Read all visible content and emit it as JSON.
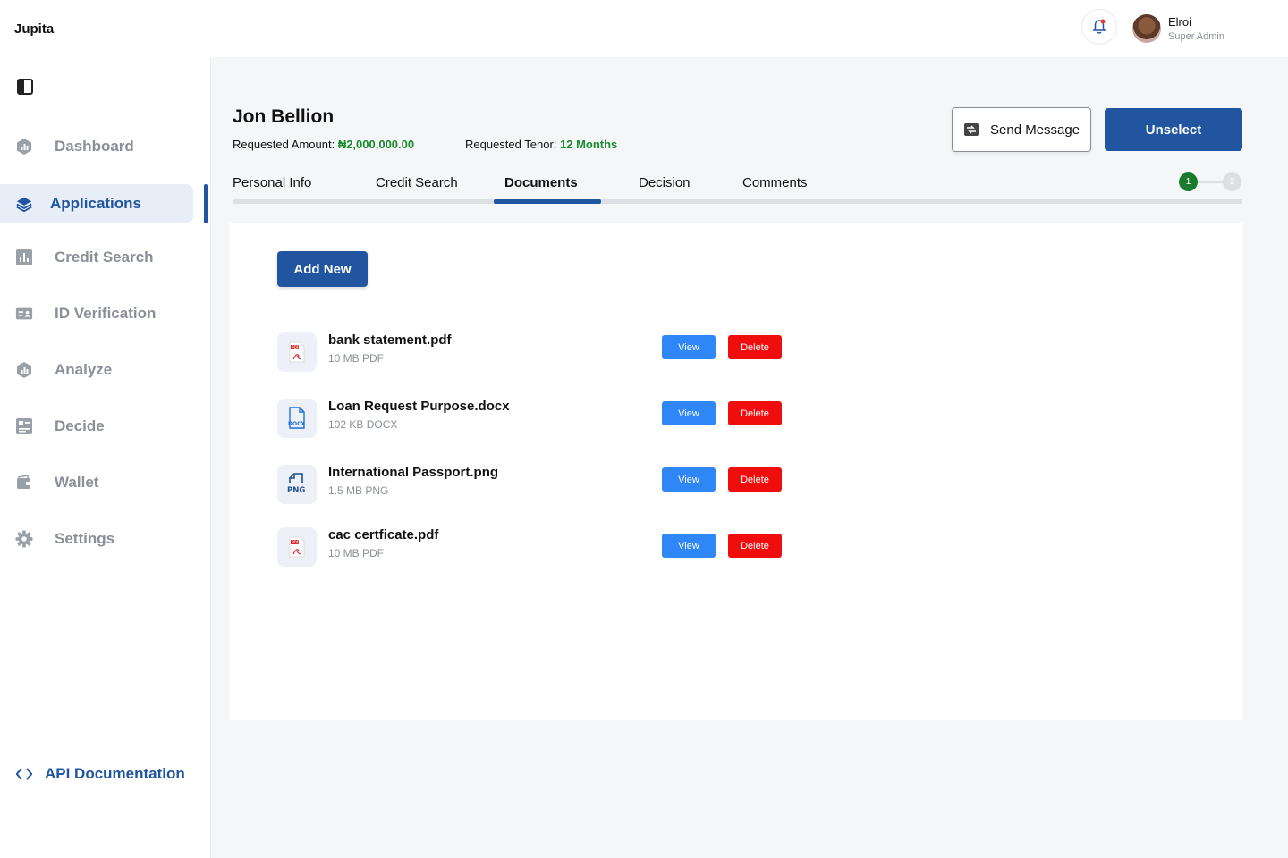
{
  "brand": "Jupita",
  "user": {
    "name": "Elroi",
    "role": "Super Admin"
  },
  "sidebar": {
    "items": [
      {
        "label": "Dashboard",
        "icon": "dashboard-icon"
      },
      {
        "label": "Applications",
        "icon": "layers-icon",
        "active": true
      },
      {
        "label": "Credit Search",
        "icon": "bar-chart-icon"
      },
      {
        "label": "ID Verification",
        "icon": "id-card-icon"
      },
      {
        "label": "Analyze",
        "icon": "analyze-icon"
      },
      {
        "label": "Decide",
        "icon": "decide-icon"
      },
      {
        "label": "Wallet",
        "icon": "wallet-icon"
      },
      {
        "label": "Settings",
        "icon": "gear-icon"
      }
    ],
    "api_doc": "API Documentation"
  },
  "applicant": {
    "name": "Jon Bellion",
    "amount_label": "Requested Amount: ",
    "amount_value": "₦2,000,000.00",
    "tenor_label": "Requested Tenor: ",
    "tenor_value": "12 Months"
  },
  "actions": {
    "send_message": "Send Message",
    "unselect": "Unselect"
  },
  "tabs": [
    {
      "label": "Personal Info"
    },
    {
      "label": "Credit Search"
    },
    {
      "label": "Documents",
      "active": true
    },
    {
      "label": "Decision"
    },
    {
      "label": "Comments"
    }
  ],
  "stepper": {
    "step1": "1",
    "step2": "2"
  },
  "documents": {
    "add_new": "Add New",
    "view_label": "View",
    "delete_label": "Delete",
    "files": [
      {
        "name": "bank statement.pdf",
        "meta": "10 MB PDF",
        "icon": "pdf-file-icon"
      },
      {
        "name": "Loan Request Purpose.docx",
        "meta": "102 KB DOCX",
        "icon": "docx-file-icon"
      },
      {
        "name": "International Passport.png",
        "meta": "1.5 MB PNG",
        "icon": "png-file-icon"
      },
      {
        "name": "cac certficate.pdf",
        "meta": "10 MB PDF",
        "icon": "pdf-file-icon"
      }
    ]
  },
  "colors": {
    "primary": "#2155a0",
    "success": "#1a8a2e",
    "view": "#2f86f6",
    "delete": "#f00d0d"
  }
}
